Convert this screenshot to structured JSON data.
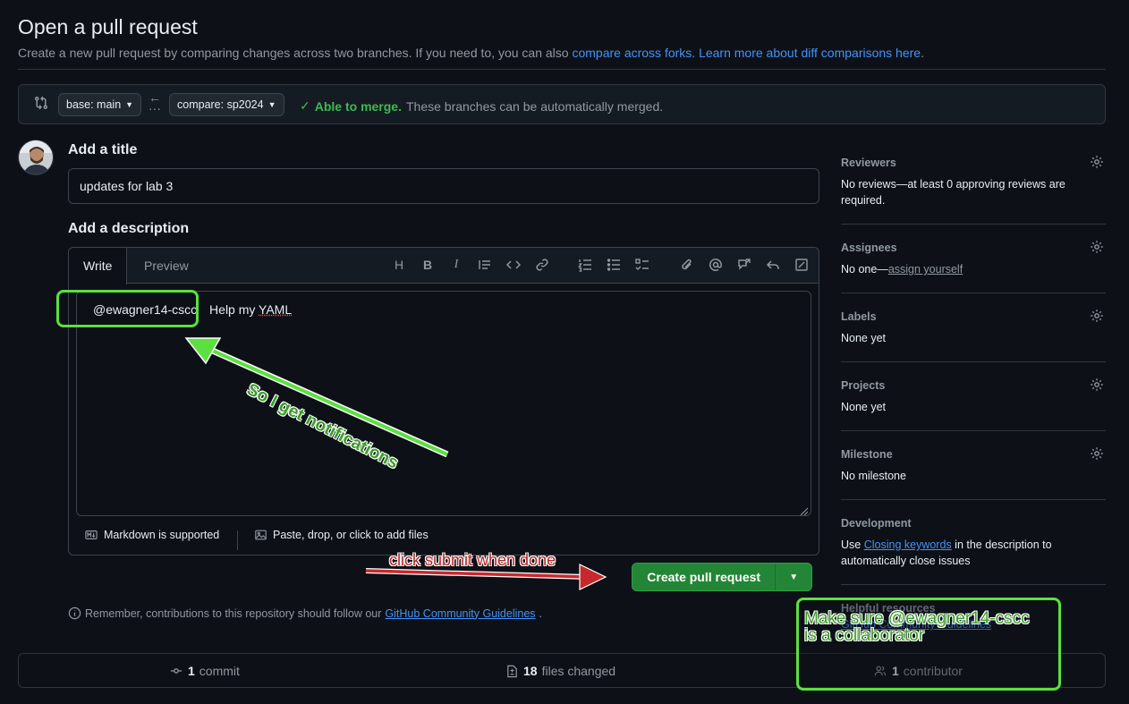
{
  "header": {
    "title": "Open a pull request",
    "subtitle_prefix": "Create a new pull request by comparing changes across two branches. If you need to, you can also",
    "link_forks": "compare across forks.",
    "link_learn": "Learn more about diff comparisons here",
    "subtitle_suffix": "."
  },
  "branches": {
    "base_label": "base: main",
    "compare_label": "compare: sp2024",
    "merge_ok": "Able to merge.",
    "merge_text": "These branches can be automatically merged."
  },
  "form": {
    "title_label": "Add a title",
    "title_value": "updates for lab 3",
    "description_label": "Add a description",
    "tab_write": "Write",
    "tab_preview": "Preview",
    "description_mention": "@ewagner14-cscc",
    "description_rest": "Help my ",
    "description_word": "YAML",
    "markdown_note": "Markdown is supported",
    "attach_note": "Paste, drop, or click to add files",
    "create_button": "Create pull request",
    "remember_text": "Remember, contributions to this repository should follow our",
    "remember_link": "GitHub Community Guidelines",
    "remember_suffix": "."
  },
  "sidebar": {
    "reviewers": {
      "title": "Reviewers",
      "body": "No reviews—at least 0 approving reviews are required."
    },
    "assignees": {
      "title": "Assignees",
      "body_prefix": "No one—",
      "link": "assign yourself"
    },
    "labels": {
      "title": "Labels",
      "body": "None yet"
    },
    "projects": {
      "title": "Projects",
      "body": "None yet"
    },
    "milestone": {
      "title": "Milestone",
      "body": "No milestone"
    },
    "development": {
      "title": "Development",
      "body_prefix": "Use",
      "link": "Closing keywords",
      "body_suffix": "in the description to automatically close issues"
    },
    "helpful": {
      "title": "Helpful resources",
      "link": "GitHub Community Guidelines"
    }
  },
  "stats": {
    "commits_count": "1",
    "commits_label": "commit",
    "files_count": "18",
    "files_label": "files changed",
    "contributors_count": "1",
    "contributors_label": "contributor"
  },
  "annotations": {
    "notifications": "So I get notifications",
    "submit": "click submit when done",
    "collaborator_line1": "Make sure @ewagner14-cscc",
    "collaborator_line2": "is a collaborator"
  },
  "colors": {
    "background": "#0d1117",
    "accent_link": "#4493f8",
    "success_green": "#3fb950",
    "create_button": "#238636",
    "annotation_green": "#5ce040",
    "annotation_red": "#c8282d"
  }
}
